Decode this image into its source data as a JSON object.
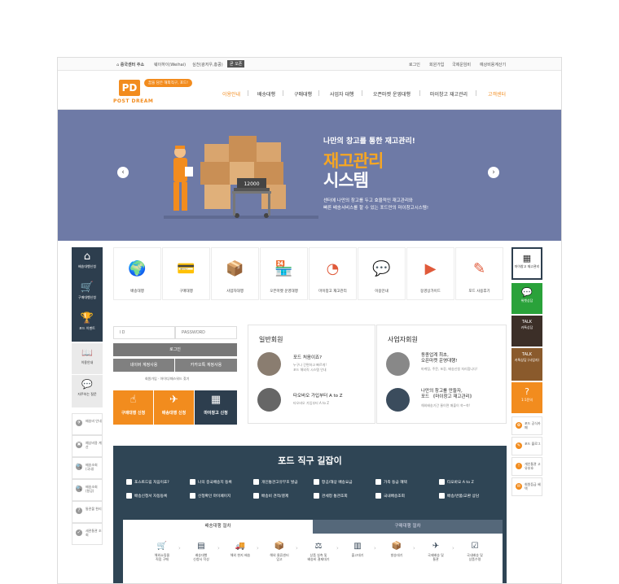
{
  "topbar": {
    "address_label": "중국센터 주소",
    "loc1": "웨이하이(Weihai)",
    "loc2": "심천(광저우,홍콩)",
    "badge": "곧 오픈",
    "links": [
      "로그인",
      "회원가입",
      "국제운임비",
      "예상비용계산기"
    ]
  },
  "header": {
    "logo_mark": "PD",
    "logo_text": "POST DREAM",
    "slogan": "꿈을 담은 해외직구, 포드!",
    "nav": [
      "이용안내",
      "배송대행",
      "구매대행",
      "사업자 대행",
      "오픈마켓 운영대행",
      "마이창고 재고관리",
      "고객센터"
    ]
  },
  "banner": {
    "sub": "나만의 창고를 통한 재고관리!",
    "title1": "재고관리",
    "title2": "시스템",
    "desc1": "센터에 나만의 창고를 두고 효율적인 재고관리와",
    "desc2": "빠른 배송서비스를 할 수 있는 포드만의 마이창고시스템!",
    "scale": "12000",
    "prev": "‹",
    "next": "›"
  },
  "left_sidebar": {
    "main": [
      {
        "icon": "⌂",
        "label": "배송대행신청"
      },
      {
        "icon": "🛒",
        "label": "구매대행신청"
      },
      {
        "icon": "🏆",
        "label": "포드 이벤트"
      }
    ],
    "gray": [
      {
        "icon": "📖",
        "label": "이용안내"
      },
      {
        "icon": "💬",
        "label": "자주하는 질문"
      }
    ],
    "small": [
      {
        "icon": "✈",
        "label": "배송비 안내"
      },
      {
        "icon": "✖",
        "label": "예상비용 계산"
      },
      {
        "icon": "🔍",
        "label": "배송조회 (국내)"
      },
      {
        "icon": "🔍",
        "label": "배송조회 (항공)"
      },
      {
        "icon": "?",
        "label": "통관불 편리"
      },
      {
        "icon": "✓",
        "label": "세관통관 조회"
      }
    ]
  },
  "services": [
    {
      "icon": "🌍",
      "label": "배송대행"
    },
    {
      "icon": "💳",
      "label": "구매대행"
    },
    {
      "icon": "📦",
      "label": "사업자대행"
    },
    {
      "icon": "🏪",
      "label": "오픈마켓 운영대행"
    },
    {
      "icon": "◔",
      "label": "마이창고 재고관리"
    },
    {
      "icon": "💬",
      "label": "이용안내"
    },
    {
      "icon": "▶",
      "label": "동영상가이드"
    },
    {
      "icon": "✎",
      "label": "포드 사용후기"
    }
  ],
  "login": {
    "id_placeholder": "I D",
    "pw_placeholder": "PASSWORD",
    "login_btn": "로그인",
    "naver": "네이버 계정사용",
    "kakao": "카카오톡 계정사용",
    "join": "회원가입",
    "find": "아이디/패스워드 찾기",
    "quick": [
      {
        "icon": "☝",
        "label": "구매대행 신청",
        "color": "#f28c1e"
      },
      {
        "icon": "✈",
        "label": "배송대행 신청",
        "color": "#f28c1e"
      },
      {
        "icon": "▦",
        "label": "마이창고 신청",
        "color": "#2d3e4e"
      }
    ]
  },
  "members": {
    "general": {
      "title": "일반회원",
      "items": [
        {
          "title1": "포드 처음이죠?",
          "desc1": "누구나 간편하고 빠르게!",
          "desc2": "포드 해외직 시스템 안내"
        },
        {
          "title1": "타오바오 가입부터 A to Z",
          "desc1": "타오바오 가입부터 A to Z",
          "desc2": ""
        }
      ]
    },
    "business": {
      "title": "사업자회원",
      "items": [
        {
          "title1": "동종업계 최초,",
          "title2": "오픈마켓 운영대행!",
          "desc1": "마케팅, 주문, 포장, 배송신청 처리합니다!"
        },
        {
          "title1": "나만의 창고를 만들자,",
          "title2": "포드 《마이창고 재고관리》",
          "desc1": "해외배송기간 줄이면 매출이 쑥~쑥!"
        }
      ]
    }
  },
  "right_sidebar": {
    "top": {
      "icon": "▦",
      "label": "마이창고 재고관리"
    },
    "colored": [
      {
        "icon": "💬",
        "label": "위챗상담",
        "color": "#2aa23a"
      },
      {
        "icon": "TALK",
        "label": "카톡상담",
        "color": "#3c2f28"
      },
      {
        "icon": "TALK",
        "label": "카톡상담 (사업자)",
        "color": "#8a5a2c"
      },
      {
        "icon": "?",
        "label": "1:1문의",
        "color": "#f28c1e"
      }
    ],
    "small": [
      {
        "icon": "✿",
        "label": "포드 공식카페"
      },
      {
        "icon": "✎",
        "label": "포드 블로그"
      },
      {
        "icon": "!",
        "label": "개인통관 고유부호"
      },
      {
        "icon": "✉",
        "label": "회원등급 혜택"
      }
    ]
  },
  "guide": {
    "title": "포드 직구 길잡이",
    "row1": [
      "포스트드림 처음이죠?",
      "나의 중국배송지 등록",
      "개인통관고유부호 발급",
      "항공/해상 배송요금",
      "가족 등급 혜택",
      "타오바오 A to Z"
    ],
    "row2": [
      "배송신청서 자동등록",
      "신청확인 마이페이지",
      "배송비 견적/결제",
      "관세청 통관조회",
      "국내배송조회",
      "배송/반품/교환 상담"
    ],
    "tab_active": "배송대행 절차",
    "tab_inactive": "구매대행 절차",
    "steps": [
      {
        "icon": "🛒",
        "label1": "해외쇼핑몰",
        "label2": "직접 구매"
      },
      {
        "icon": "▤",
        "label1": "배송대행",
        "label2": "신청서 작성"
      },
      {
        "icon": "🚚",
        "label1": "해외 현지 배송",
        "label2": ""
      },
      {
        "icon": "📦",
        "label1": "해외 물류센터",
        "label2": "입고"
      },
      {
        "icon": "⚖",
        "label1": "상품 실측 및",
        "label2": "배송비 결제대기"
      },
      {
        "icon": "▥",
        "label1": "출고대기",
        "label2": ""
      },
      {
        "icon": "📦",
        "label1": "발송대기",
        "label2": ""
      },
      {
        "icon": "✈",
        "label1": "국제배송 및",
        "label2": "통관"
      },
      {
        "icon": "☑",
        "label1": "국내배송 및",
        "label2": "상품수령"
      }
    ]
  }
}
